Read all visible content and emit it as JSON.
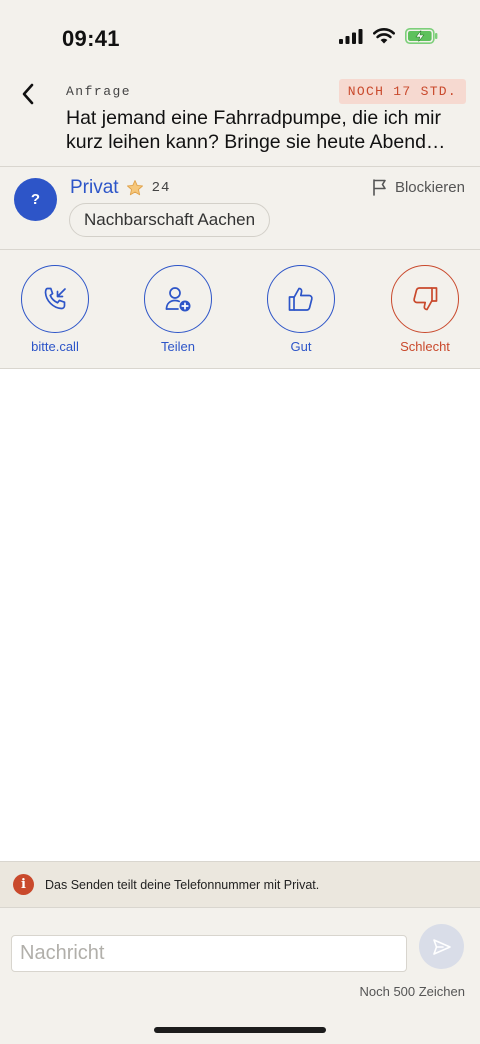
{
  "status_bar": {
    "time": "09:41"
  },
  "header": {
    "label": "Anfrage",
    "deadline": "NOCH 17 STD.",
    "title_line1": "Hat jemand eine Fahrradpumpe, die ich mir",
    "title_line2": "kurz leihen kann? Bringe sie heute Abend…"
  },
  "profile": {
    "avatar_text": "?",
    "name": "Privat",
    "score": "24",
    "block_label": "Blockieren",
    "community": "Nachbarschaft Aachen"
  },
  "actions": [
    {
      "label": "bitte.call",
      "icon": "incoming-call-icon"
    },
    {
      "label": "Teilen",
      "icon": "add-user-icon"
    },
    {
      "label": "Gut",
      "icon": "thumbs-up-icon"
    },
    {
      "label": "Schlecht",
      "icon": "thumbs-down-icon"
    }
  ],
  "info": {
    "icon_text": "i",
    "text": "Das Senden teilt deine Telefonnummer mit Privat."
  },
  "composer": {
    "placeholder": "Nachricht",
    "value": "",
    "char_count": "Noch 500 Zeichen"
  },
  "colors": {
    "accent": "#2d55c8",
    "danger": "#c9492c",
    "background": "#f3f1ec",
    "deadline_bg": "#f6d9d0"
  }
}
